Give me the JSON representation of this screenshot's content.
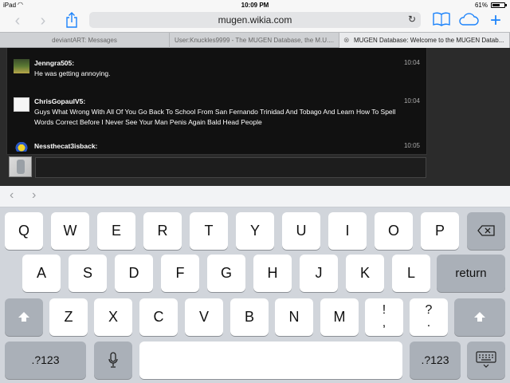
{
  "status_bar": {
    "device": "iPad",
    "time": "10:09 PM",
    "battery_percent": "61%",
    "battery_level": 0.61
  },
  "toolbar": {
    "url": "mugen.wikia.com",
    "icons": [
      "back-chevron-icon",
      "forward-chevron-icon",
      "share-icon",
      "reload-icon",
      "bookmarks-book-icon",
      "icloud-tabs-icon",
      "new-tab-plus-icon"
    ]
  },
  "tabs": [
    {
      "title": "deviantART: Messages"
    },
    {
      "title": "User:Knuckles9999 - The MUGEN Database, the M.U...."
    },
    {
      "title": "MUGEN Database: Welcome to the MUGEN Datab..."
    }
  ],
  "chat": {
    "messages": [
      {
        "user": "Jenngra505:",
        "text": "He was getting annoying.",
        "time": "10:04"
      },
      {
        "user": "ChrisGopaulV5:",
        "text": "Guys What Wrong With All Of You Go Back To School From San Fernando Trinidad And Tobago And Learn How To Spell Words Correct Before I Never See Your Man Penis Again Bald Head People",
        "time": "10:04"
      },
      {
        "user": "Nessthecat3isback:",
        "text": "",
        "time": "10:05"
      }
    ]
  },
  "keyboard": {
    "row1": [
      "Q",
      "W",
      "E",
      "R",
      "T",
      "Y",
      "U",
      "I",
      "O",
      "P"
    ],
    "row2": [
      "A",
      "S",
      "D",
      "F",
      "G",
      "H",
      "J",
      "K",
      "L"
    ],
    "row3": [
      "Z",
      "X",
      "C",
      "V",
      "B",
      "N",
      "M"
    ],
    "punct1": {
      "top": "!",
      "bottom": ","
    },
    "punct2": {
      "top": "?",
      "bottom": "."
    },
    "return_label": "return",
    "numbers_label": ".?123"
  }
}
